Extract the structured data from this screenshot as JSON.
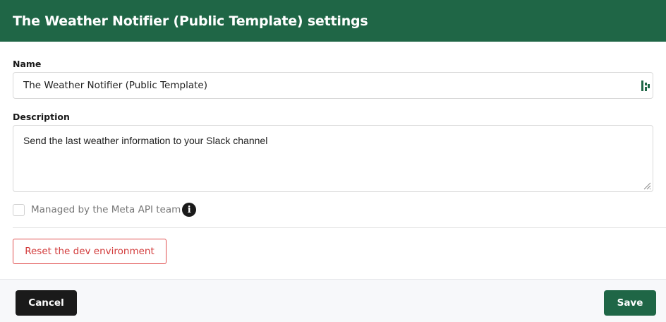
{
  "header": {
    "title": "The Weather Notifier (Public Template) settings"
  },
  "form": {
    "name_label": "Name",
    "name_value": "The Weather Notifier (Public Template)",
    "description_label": "Description",
    "description_value": "Send the last weather information to your Slack channel",
    "managed_label": "Managed by the Meta API team",
    "managed_checked": false,
    "info_icon": "info-icon",
    "reset_label": "Reset the dev environment"
  },
  "footer": {
    "cancel_label": "Cancel",
    "save_label": "Save"
  },
  "colors": {
    "brand": "#1f6646",
    "danger": "#d23a3a",
    "dark": "#1a1a1a"
  }
}
